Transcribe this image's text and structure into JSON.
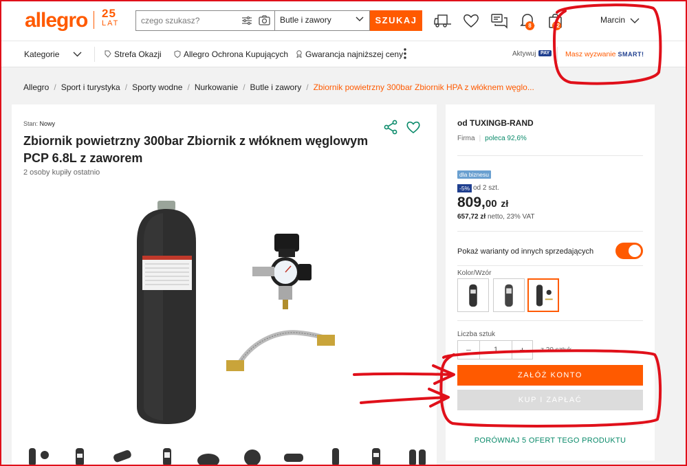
{
  "header": {
    "logo_text": "allegro",
    "logo_25": "25",
    "logo_lat": "LAT",
    "search_placeholder": "czego szukasz?",
    "search_category": "Butle i zawory",
    "search_button": "SZUKAJ",
    "notifications_count": "8",
    "cart_count": "52",
    "user_name": "Marcin"
  },
  "subnav": {
    "categories": "Kategorie",
    "links": [
      "Strefa Okazji",
      "Allegro Ochrona Kupujących",
      "Gwarancja najniższej ceny"
    ],
    "activate": "Aktywuj",
    "pay": "PAY",
    "smart_challenge": "Masz wyzwanie",
    "smart": "SMART!"
  },
  "breadcrumb": {
    "items": [
      "Allegro",
      "Sport i turystyka",
      "Sporty wodne",
      "Nurkowanie",
      "Butle i zawory"
    ],
    "current": "Zbiornik powietrzny 300bar Zbiornik HPA z włóknem węglo..."
  },
  "product": {
    "condition_label": "Stan:",
    "condition_value": "Nowy",
    "title": "Zbiornik powietrzny 300bar Zbiornik z włóknem węglowym PCP 6.8L z zaworem",
    "bought_recently": "2 osoby kupiły ostatnio"
  },
  "offer": {
    "seller": "od TUXINGB-RAND",
    "seller_type": "Firma",
    "recommend": "poleca 92,6%",
    "business_badge": "dla biznesu",
    "discount": "-5%",
    "discount_condition": "od 2 szt.",
    "price_main": "809,",
    "price_cents": "00",
    "price_currency": "zł",
    "netto_value": "657,72 zł",
    "netto_text": "netto, 23% VAT",
    "variants_toggle_label": "Pokaż warianty od innych sprzedających",
    "color_label": "Kolor/Wzór",
    "qty_label": "Liczba sztuk",
    "qty_value": "1",
    "qty_of": "z 20 sztuk",
    "create_account": "ZAŁÓŻ KONTO",
    "buy_pay": "KUP I ZAPŁAĆ",
    "compare": "PORÓWNAJ 5 OFERT TEGO PRODUKTU"
  },
  "colors": {
    "accent": "#ff5a00",
    "annotation": "#e0101a",
    "link_green": "#0a8a6a"
  }
}
